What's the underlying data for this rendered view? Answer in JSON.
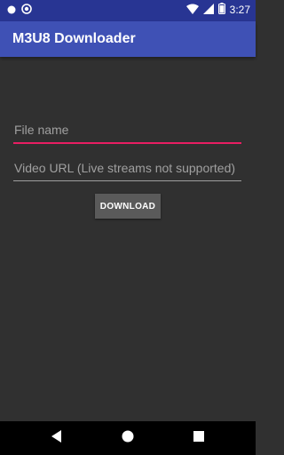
{
  "status_bar": {
    "time": "3:27",
    "icons": [
      "notification-dot-icon",
      "sync-circle-icon",
      "wifi-icon",
      "cellular-signal-icon",
      "battery-icon"
    ]
  },
  "app_bar": {
    "title": "M3U8 Downloader"
  },
  "form": {
    "file_name": {
      "value": "",
      "placeholder": "File name"
    },
    "video_url": {
      "value": "",
      "placeholder": "Video URL (Live streams not supported)"
    },
    "download_label": "DOWNLOAD"
  },
  "nav_bar": {
    "icons": [
      "back-icon",
      "home-icon",
      "recents-icon"
    ]
  },
  "colors": {
    "primary": "#3f51b5",
    "primary_dark": "#283593",
    "accent": "#e91e63",
    "background": "#303030"
  }
}
